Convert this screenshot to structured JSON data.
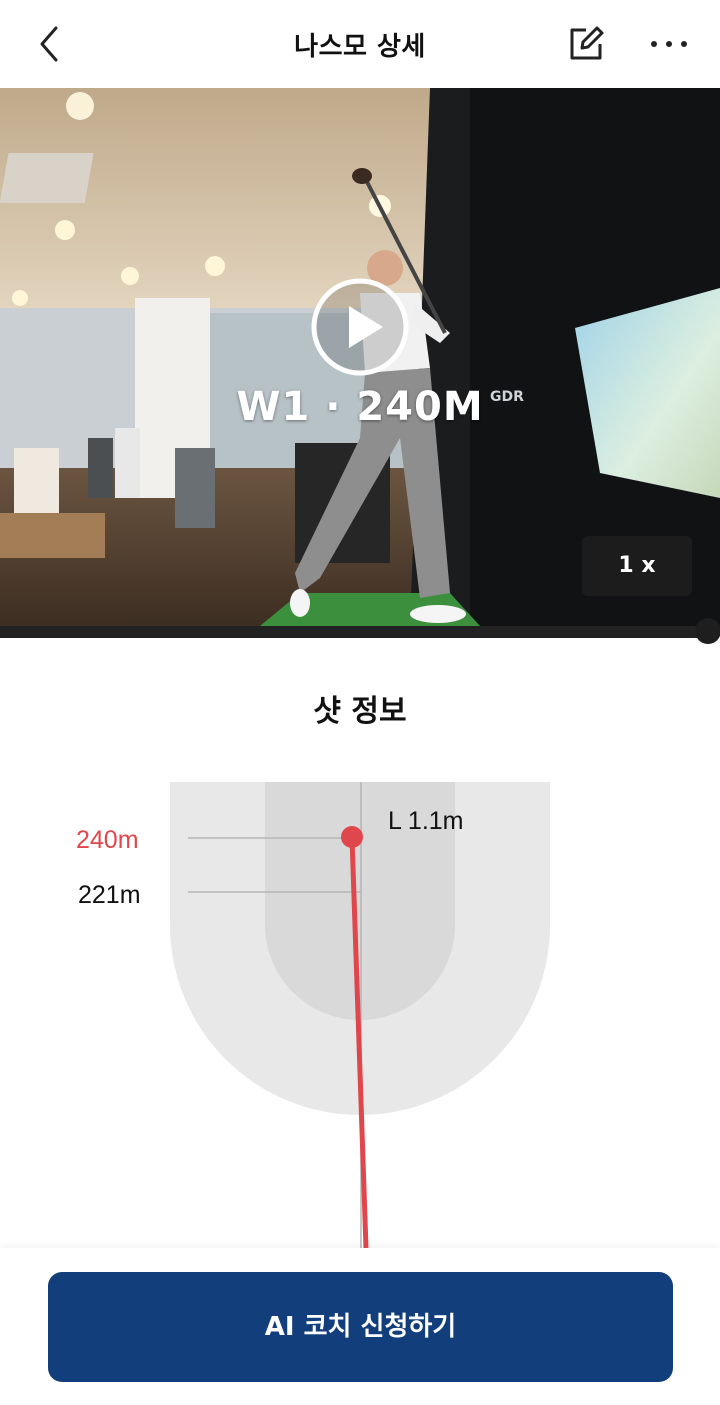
{
  "header": {
    "title": "나스모 상세",
    "back_icon": "chevron-left-icon",
    "edit_icon": "edit-icon",
    "more_icon": "more-horizontal-icon"
  },
  "video": {
    "shot_label": "W1 · 240M",
    "speed_label": "1 x",
    "overlay_brand": "GDR",
    "progress": 1.0
  },
  "shot_info": {
    "title": "샷 정보",
    "carry_label": "240m",
    "carry_color": "#e0474c",
    "run_label": "221m",
    "side_label": "L 1.1m"
  },
  "cta": {
    "label": "AI 코치 신청하기",
    "color": "#123e7c"
  }
}
